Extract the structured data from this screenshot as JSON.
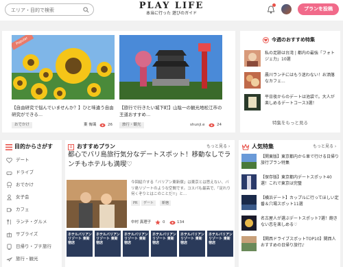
{
  "header": {
    "search_placeholder": "エリア・目的で検索",
    "logo_title": "PLAY LIFE",
    "logo_sub": "本当に行った 遊びのガイド",
    "post_button": "プランを投稿"
  },
  "featured": {
    "ribbon": "Popular",
    "items": [
      {
        "title": "【自由研究で悩んでいませんか？】ひと味違う自由研究ができる...",
        "tag": "おでかけ",
        "user": "東 侑璃",
        "views": "26"
      },
      {
        "title": "【旅行で行きたい城下町】山陰一の観光地松江市の王道おすすめ...",
        "tag": "旅行・観光",
        "user": "shunji.e",
        "views": "24"
      }
    ]
  },
  "weekly": {
    "heading": "今週のおすすめ特集",
    "items": [
      {
        "text": "私の足跡は台湾 | 都内の最強「フォトジェ力」10選"
      },
      {
        "text": "晨川ランチにはもう迷わない！お洒落なカフェ..."
      },
      {
        "text": "平日夜からのデートは池袋で。大人が楽しめるデートコース3選！"
      }
    ],
    "more": "特集をもっと見る"
  },
  "purpose": {
    "heading": "目的からさがす",
    "items": [
      {
        "label": "デート",
        "icon": "heart-icon"
      },
      {
        "label": "ドライブ",
        "icon": "car-icon"
      },
      {
        "label": "おでかけ",
        "icon": "stroller-icon"
      },
      {
        "label": "女子会",
        "icon": "woman-icon"
      },
      {
        "label": "カフェ",
        "icon": "cup-icon"
      },
      {
        "label": "ランチ・グルメ",
        "icon": "fork-icon"
      },
      {
        "label": "サプライズ",
        "icon": "gift-icon"
      },
      {
        "label": "日帰り・プチ旅行",
        "icon": "train-icon"
      },
      {
        "label": "旅行・観光",
        "icon": "plane-icon"
      }
    ]
  },
  "plan": {
    "heading": "おすすめプラン",
    "more": "もっと見る",
    "title": "都心でバリ島旅行気分なデートスポット！移動なしでランチもホテルも満喫♡",
    "desc": "今回紹介する「バリアン東新宿」は東京とは思えない、バリ島リゾートのような空間です。コスパも最高で、「足れり何くぞりとはこのことだ!!」と...",
    "tags": [
      "PR",
      "デート",
      "新宿"
    ],
    "user": "中村 真理子",
    "stars": "0",
    "views": "134",
    "thumb_label": "ホテルバリアンリゾート\n東新宿店"
  },
  "features": {
    "heading": "人気特集",
    "more": "もっと見る",
    "items": [
      {
        "text": "【関東版】東京都内から車で行ける日帰り旅行プラン特集"
      },
      {
        "text": "【保存版】東京都内デートスポット40選！これで東京は完璧"
      },
      {
        "text": "【横浜デート】カップルに行ってほしい定番＆穴場スポット11選"
      },
      {
        "text": "名古屋人が選ぶデートスポット7選！飽きない恋を楽しめる♡"
      },
      {
        "text": "【関西ドライブスポットTOP10】関西人おすすめの日帰り旅行♪"
      }
    ]
  },
  "colors": {
    "accent": "#f16a8a",
    "ribbon": "#e87a6a",
    "eye": "#e8524a"
  }
}
